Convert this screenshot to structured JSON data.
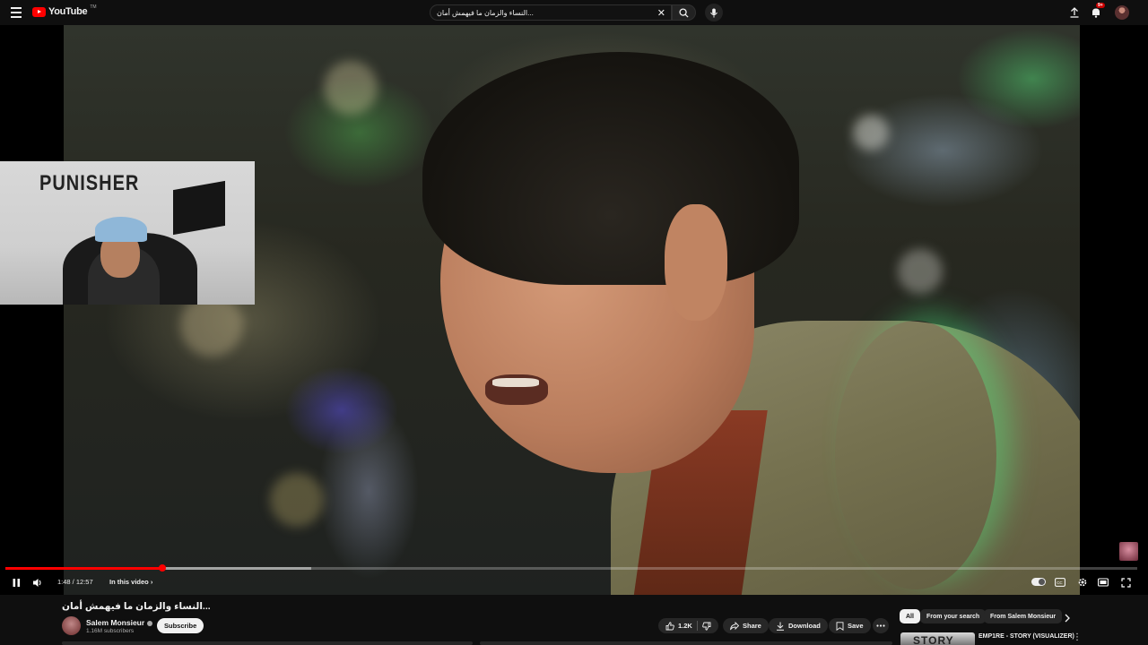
{
  "header": {
    "logo_text": "YouTube",
    "logo_sup": "TM",
    "search_query": "النساء والزمان ما فيهمش أمان...",
    "notification_count": "9+"
  },
  "player": {
    "webcam_poster_text": "PUNISHER",
    "current_time": "1:48",
    "duration": "12:57",
    "time_display": "1:48 / 12:57",
    "progress_fraction": 0.139,
    "buffered_fraction": 0.27,
    "chapter_label": "In this video"
  },
  "video": {
    "title": "النساء والزمان ما فيهمش أمان...",
    "channel_name": "Salem Monsieur",
    "subscribers": "1.16M subscribers",
    "subscribe_label": "Subscribe",
    "like_count": "1.2K",
    "share_label": "Share",
    "download_label": "Download",
    "save_label": "Save"
  },
  "recommendations": {
    "chips": [
      "All",
      "From your search",
      "From Salem Monsieur"
    ],
    "first_item_title": "EMP1RE - STORY (VISUALIZER)",
    "first_item_thumb_text": "STORY"
  },
  "colors": {
    "accent": "#ff0000",
    "background": "#0f0f0f",
    "pill_bg": "#272727"
  }
}
